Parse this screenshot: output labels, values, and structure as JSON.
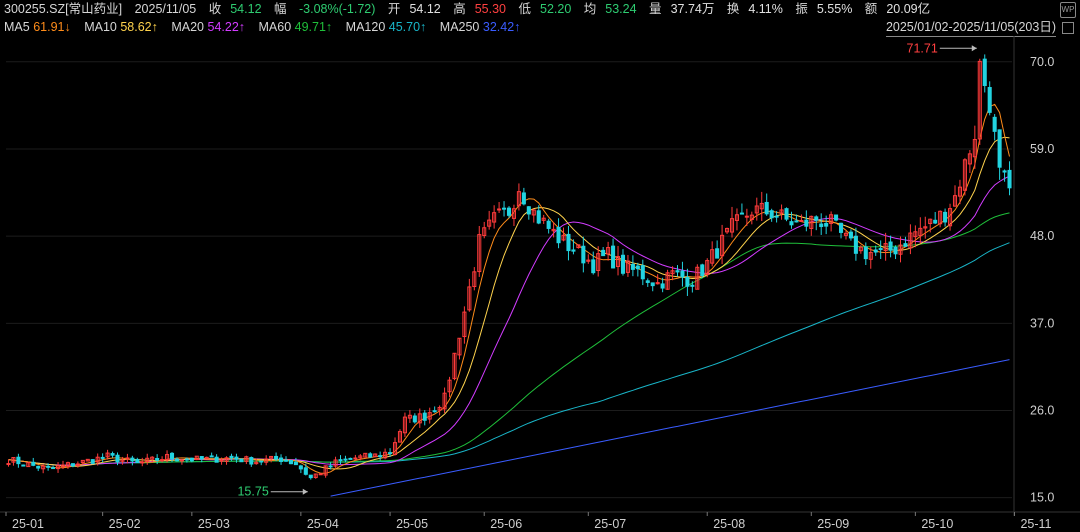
{
  "header": {
    "code": "300255.SZ[常山药业]",
    "date": "2025/11/05",
    "close_label": "收",
    "close": "54.12",
    "change_label": "幅",
    "change": "-3.08%(-1.72)",
    "open_label": "开",
    "open": "54.12",
    "high_label": "高",
    "high": "55.30",
    "low_label": "低",
    "low": "52.20",
    "avg_label": "均",
    "avg": "53.24",
    "volume_label": "量",
    "volume": "37.74万",
    "turnover_label": "换",
    "turnover": "4.11%",
    "amplitude_label": "振",
    "amplitude": "5.55%",
    "amount_label": "额",
    "amount": "20.09亿",
    "logo_text": "WP"
  },
  "ma_legend": [
    {
      "name": "MA5",
      "value": "61.91↓",
      "color": "#ff8c1a"
    },
    {
      "name": "MA10",
      "value": "58.62↑",
      "color": "#ffd34d"
    },
    {
      "name": "MA20",
      "value": "54.22↑",
      "color": "#d23cff"
    },
    {
      "name": "MA60",
      "value": "49.71↑",
      "color": "#1fbf3a"
    },
    {
      "name": "MA120",
      "value": "45.70↑",
      "color": "#19b5c8"
    },
    {
      "name": "MA250",
      "value": "32.42↑",
      "color": "#3a5cff"
    }
  ],
  "date_range": "2025/01/02-2025/11/05(203日)",
  "chart_data": {
    "type": "candlestick",
    "y_ticks": [
      "70.0",
      "59.0",
      "48.0",
      "37.0",
      "26.0",
      "15.0"
    ],
    "y_tick_values": [
      70,
      59,
      48,
      37,
      26,
      15
    ],
    "ylim": [
      14.2,
      72.5
    ],
    "x_ticks": [
      "25-01",
      "25-02",
      "25-03",
      "25-04",
      "25-05",
      "25-06",
      "25-07",
      "25-08",
      "25-09",
      "25-10",
      "25-11"
    ],
    "x_tick_index": [
      0,
      19,
      37,
      59,
      77,
      96,
      117,
      141,
      162,
      183,
      203
    ],
    "n_bars": 203,
    "annotations": [
      {
        "text": "71.71",
        "value": 71.71,
        "index": 196,
        "color": "#ff4040"
      },
      {
        "text": "15.75",
        "value": 15.75,
        "index": 61,
        "color": "#2ecc71"
      }
    ],
    "up_color": "#ff3b3b",
    "down_color": "#22d3e0",
    "close_anchor": {
      "index": [
        0,
        8,
        15,
        20,
        26,
        32,
        38,
        45,
        50,
        55,
        58,
        61,
        66,
        70,
        74,
        77,
        80,
        84,
        88,
        92,
        95,
        98,
        101,
        103,
        106,
        109,
        112,
        115,
        118,
        121,
        124,
        127,
        131,
        134,
        138,
        141,
        146,
        150,
        154,
        157,
        160,
        163,
        166,
        170,
        173,
        176,
        179,
        183,
        186,
        189,
        191,
        193,
        195,
        196,
        198,
        200,
        202
      ],
      "close": [
        19.8,
        18.6,
        19.5,
        20.2,
        19.3,
        20.1,
        19.8,
        20.0,
        19.6,
        19.9,
        19.3,
        17.5,
        19.4,
        20.0,
        20.3,
        20.8,
        24.8,
        25.3,
        27.5,
        38.5,
        47.2,
        50.0,
        51.2,
        54.3,
        51.0,
        49.0,
        47.2,
        46.0,
        44.5,
        45.6,
        44.0,
        43.5,
        42.0,
        43.2,
        42.5,
        44.5,
        49.0,
        51.3,
        51.0,
        50.0,
        49.4,
        50.2,
        49.5,
        46.8,
        46.0,
        45.8,
        46.5,
        48.5,
        49.5,
        51.0,
        53.0,
        57.0,
        61.0,
        69.5,
        65.0,
        55.8,
        54.1
      ]
    }
  }
}
